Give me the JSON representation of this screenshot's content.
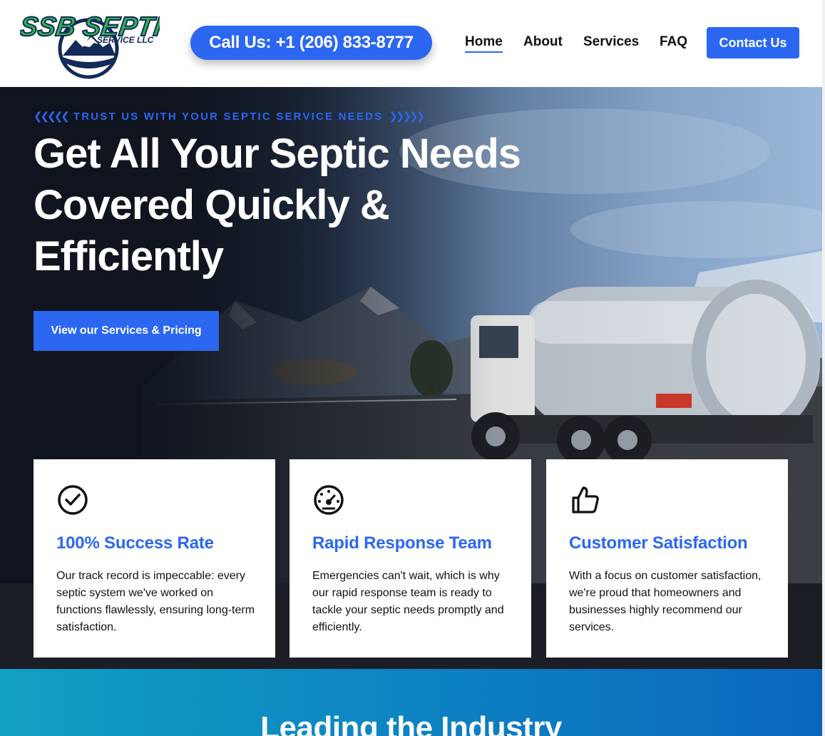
{
  "header": {
    "logo": {
      "main_text": "SSB SEPTIC",
      "sub_text": "SERVICE LLC"
    },
    "call_button": "Call Us: +1 (206) 833-8777",
    "nav": [
      {
        "label": "Home",
        "active": true
      },
      {
        "label": "About",
        "active": false
      },
      {
        "label": "Services",
        "active": false
      },
      {
        "label": "FAQ",
        "active": false
      }
    ],
    "contact_button": "Contact Us"
  },
  "hero": {
    "eyebrow": "TRUST US WITH YOUR SEPTIC SERVICE NEEDS",
    "title_lines": [
      "Get All Your Septic Needs",
      "Covered Quickly &",
      "Efficiently"
    ],
    "cta": "View our Services & Pricing"
  },
  "features": [
    {
      "icon": "check-circle-icon",
      "title": "100% Success Rate",
      "text": "Our track record is impeccable: every septic system we've worked on functions flawlessly, ensuring long-term satisfaction."
    },
    {
      "icon": "gauge-icon",
      "title": "Rapid Response Team",
      "text": "Emergencies can't wait, which is why our rapid response team is ready to tackle your septic needs promptly and efficiently."
    },
    {
      "icon": "thumbs-up-icon",
      "title": "Customer Satisfaction",
      "text": "With a focus on customer satisfaction, we're proud that homeowners and businesses highly recommend our services."
    }
  ],
  "section": {
    "heading": "Leading the Industry"
  },
  "colors": {
    "accent": "#2b67f0",
    "dark": "#161d2b"
  }
}
